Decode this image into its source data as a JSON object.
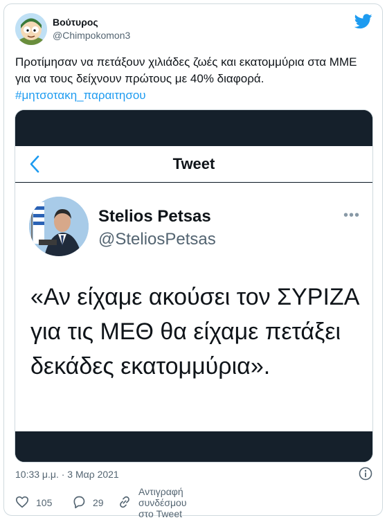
{
  "author": {
    "name": "Βούτυρος",
    "handle": "@Chimpokomon3"
  },
  "icons": {
    "brand": "twitter-bird-icon",
    "info": "info-icon",
    "like": "heart-icon",
    "reply": "reply-icon",
    "link": "link-icon",
    "back": "chevron-left-icon",
    "more": "more-dots-icon"
  },
  "colors": {
    "brand": "#1d9bf0",
    "text": "#0f1419",
    "muted": "#536471",
    "dark_bar": "#15202b"
  },
  "tweet": {
    "text": "Προτίμησαν να πετάξουν χιλιάδες ζωές και εκατομμύρια στα ΜΜΕ για να τους δείχνουν πρώτους με 40% διαφορά.",
    "hashtag": "#μητσοτακη_παραιτησου",
    "timestamp": "10:33 μ.μ. · 3 Μαρ 2021"
  },
  "embedded": {
    "nav_title": "Tweet",
    "name": "Stelios Petsas",
    "handle": "@SteliosPetsas",
    "more": "•••",
    "quote": "«Αν είχαμε ακούσει τον ΣΥΡΙΖΑ για τις ΜΕΘ θα είχαμε πετάξει δεκάδες εκατομμύρια»."
  },
  "actions": {
    "likes": "105",
    "replies": "29",
    "copy_link": "Αντιγραφή συνδέσμου στο Tweet"
  }
}
